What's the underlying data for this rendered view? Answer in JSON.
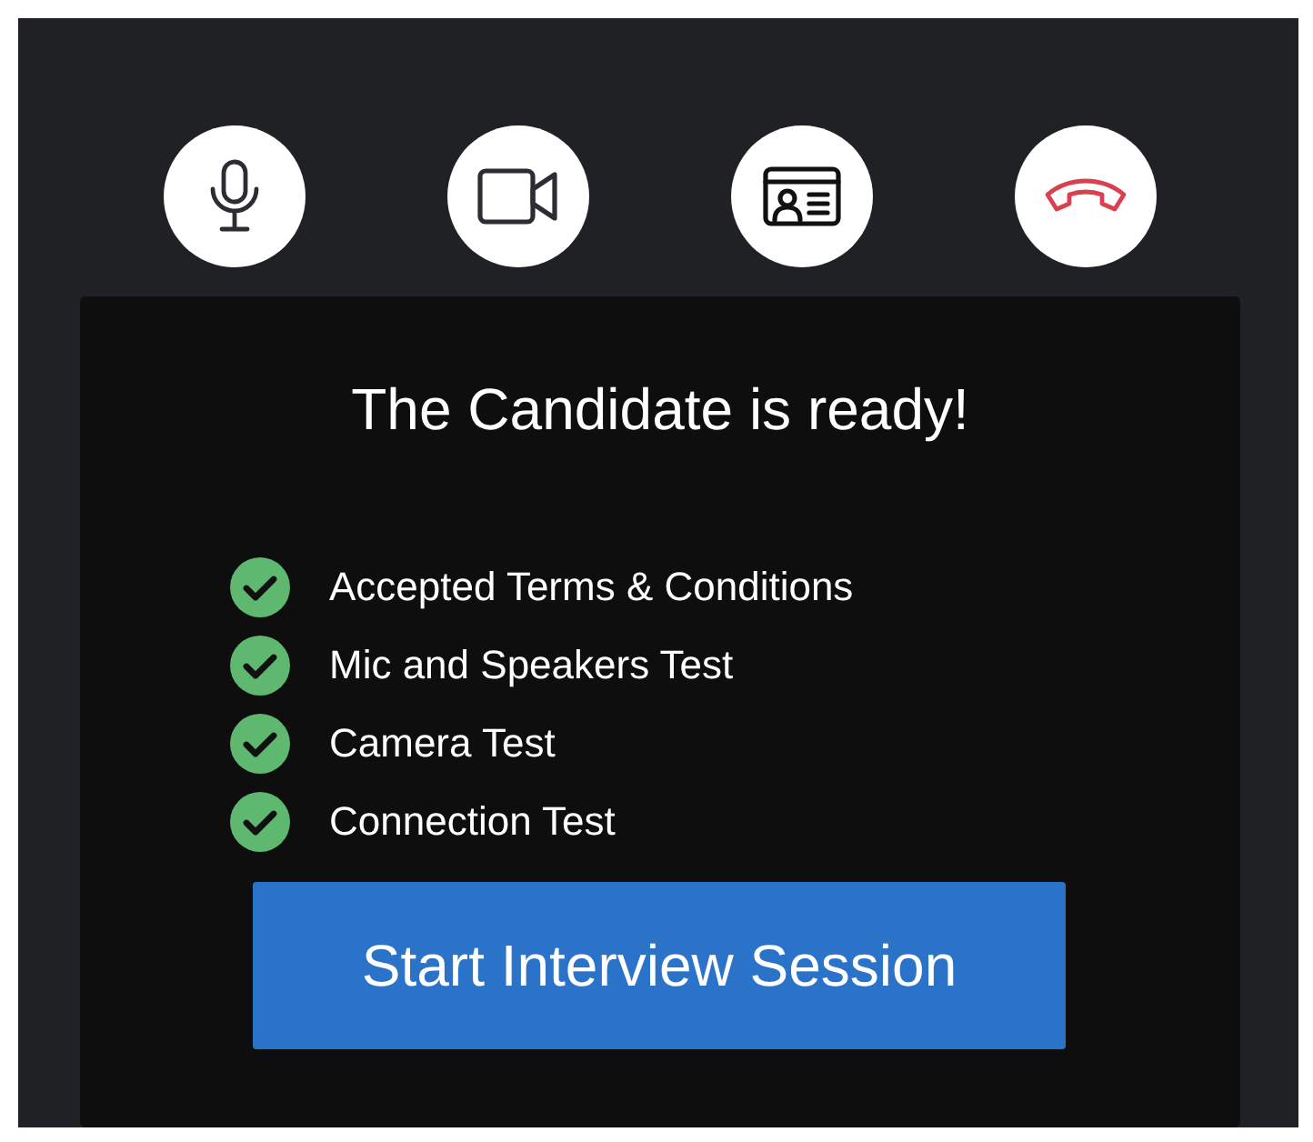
{
  "controls": [
    {
      "kind": "microphone"
    },
    {
      "kind": "camera"
    },
    {
      "kind": "id-card"
    },
    {
      "kind": "hang-up"
    }
  ],
  "card": {
    "title": "The Candidate is ready!",
    "checklist": [
      {
        "label": "Accepted Terms & Conditions",
        "checked": true
      },
      {
        "label": "Mic and Speakers Test",
        "checked": true
      },
      {
        "label": "Camera Test",
        "checked": true
      },
      {
        "label": "Connection Test",
        "checked": true
      }
    ],
    "start_button": "Start Interview Session"
  }
}
